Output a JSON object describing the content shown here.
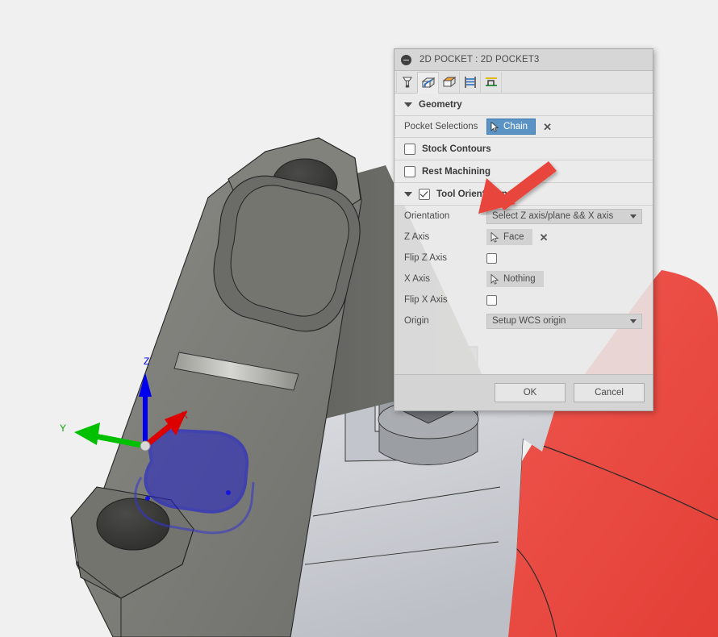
{
  "app": {
    "background_color": "#f0f0f0"
  },
  "dialog": {
    "title": "2D POCKET : 2D POCKET3",
    "collapse_icon": "minus-circle-icon",
    "tabs": [
      {
        "name": "tool-tab",
        "icon": "endmill-tool-icon",
        "active": false
      },
      {
        "name": "geometry-tab",
        "icon": "geometry-cube-icon",
        "active": true
      },
      {
        "name": "heights-tab",
        "icon": "heights-cube-icon",
        "active": false
      },
      {
        "name": "passes-tab",
        "icon": "passes-icon",
        "active": false
      },
      {
        "name": "linking-tab",
        "icon": "linking-icon",
        "active": false
      }
    ],
    "sections": {
      "geometry": {
        "label": "Geometry",
        "expanded": true,
        "pocket_selections": {
          "label": "Pocket Selections",
          "button_label": "Chain",
          "button_icon": "cursor-arrow-icon",
          "button_active": true,
          "clear_icon": "x-clear-icon"
        }
      },
      "stock_contours": {
        "label": "Stock Contours",
        "checked": false
      },
      "rest_machining": {
        "label": "Rest Machining",
        "checked": false
      },
      "tool_orientation": {
        "label": "Tool Orientation",
        "checked": true,
        "expanded": true,
        "fields": {
          "orientation": {
            "label": "Orientation",
            "value": "Select Z axis/plane && X axis",
            "type": "dropdown"
          },
          "z_axis": {
            "label": "Z Axis",
            "button_label": "Face",
            "button_icon": "cursor-arrow-icon",
            "clear_icon": "x-clear-icon"
          },
          "flip_z_axis": {
            "label": "Flip Z Axis",
            "checked": false
          },
          "x_axis": {
            "label": "X Axis",
            "button_label": "Nothing",
            "button_icon": "cursor-arrow-icon"
          },
          "flip_x_axis": {
            "label": "Flip X Axis",
            "checked": false
          },
          "origin": {
            "label": "Origin",
            "value": "Setup WCS origin",
            "type": "dropdown"
          }
        }
      }
    },
    "footer": {
      "ok_label": "OK",
      "cancel_label": "Cancel"
    }
  },
  "viewport": {
    "axis_triad": {
      "z_label": "Z",
      "z_color": "#0000ee",
      "y_label": "Y",
      "y_color": "#00c000",
      "x_label": "X",
      "x_color": "#dd0000"
    },
    "selection_highlight_color": "#1414dc",
    "red_body_color": "#ee4444",
    "gray_body_color": "#7a7a76",
    "light_body_color": "#cdcfd4"
  },
  "annotation": {
    "arrow": {
      "name": "red-callout-arrow",
      "color": "#e8453c",
      "points_to": "Tool Orientation"
    }
  }
}
